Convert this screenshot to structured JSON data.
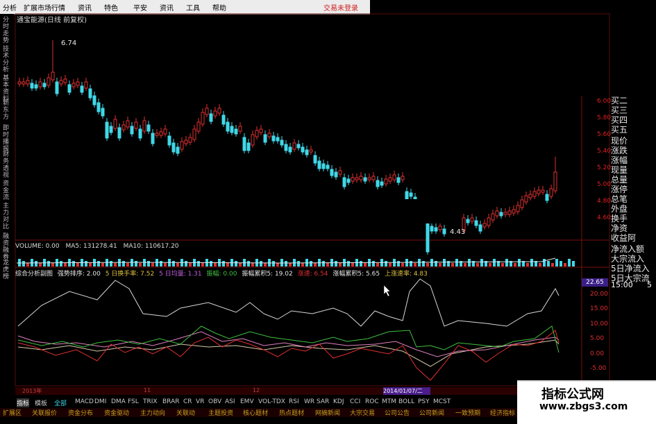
{
  "menu": {
    "items": [
      "分析",
      "扩展市场行情",
      "资讯",
      "特色",
      "平安",
      "资讯",
      "工具",
      "帮助"
    ],
    "trade_status": "交易未登录"
  },
  "stock_title": "通宝能源(日线 前复权)",
  "left_sidebar": [
    "分时走势",
    "技术分析",
    "基本资料",
    "新东方",
    "即时播报",
    "财务透视",
    "资金流",
    "主力对比",
    "融资融券",
    "龙虎榜"
  ],
  "price_axis": [
    "6.00",
    "5.80",
    "5.60",
    "5.40",
    "5.20",
    "5.00",
    "4.80",
    "4.60"
  ],
  "annotations": {
    "high": "6.74",
    "low": "4.43"
  },
  "quote_labels": [
    "买二",
    "买三",
    "买四",
    "买五",
    "现价",
    "涨跌",
    "涨幅",
    "现量",
    "总量",
    "涨停",
    "总笔",
    "外盘",
    "换手",
    "净资",
    "收益阿",
    "净流入额",
    "大宗流入",
    "5日净流入",
    "5日大宗流",
    "15:00",
    "5"
  ],
  "volume": {
    "label": "VOLUME: 0.00",
    "ma5": "MA5: 131278.41",
    "ma10": "MA10: 110617.20"
  },
  "indicator": {
    "name": "综合分析副图",
    "s1": "强势排序: 2.00",
    "s2": "5 日换手率: 7.52",
    "s3": "5 日均量: 1.31",
    "s4": "振幅: 0.00",
    "s5": "振幅累积5: 19.02",
    "s6": "涨速: 6.54",
    "s7": "涨幅累积5: 5.65",
    "s8": "上涨速率: 4.83",
    "value_box": "22.65",
    "axis": [
      "20.00",
      "15.00",
      "10.00",
      "5.00",
      "0.00",
      "-5.00"
    ]
  },
  "dates": {
    "left": "2013年",
    "d1": "11",
    "d2": "12",
    "selected": "2014/01/07/二"
  },
  "tabs": [
    "指标",
    "模板",
    "全部",
    "MACD",
    "DMI",
    "DMA",
    "FSL",
    "TRIX",
    "BRAR",
    "CR",
    "VR",
    "OBV",
    "ASI",
    "EMV",
    "VOL-TDX",
    "RSI",
    "WR",
    "SAR",
    "KDJ",
    "CCI",
    "ROC",
    "MTM",
    "BOLL",
    "PSY",
    "MCST"
  ],
  "bottom_nav": [
    "扩展区",
    "关联报价",
    "资金分布",
    "资金驱动",
    "主力动向",
    "关联动",
    "主题投资",
    "核心题材",
    "热点题材",
    "网摘新闻",
    "大宗交易",
    "公司公告",
    "公司新闻",
    "一致预期",
    "经济指标"
  ],
  "watermark": {
    "line1": "指标公式网",
    "line2": "www.zbgs3.com"
  },
  "colors": {
    "up": "#e03030",
    "down": "#40d8e8",
    "axis": "#e02020",
    "white_line": "#d8d8d8",
    "green_line": "#40c040"
  }
}
